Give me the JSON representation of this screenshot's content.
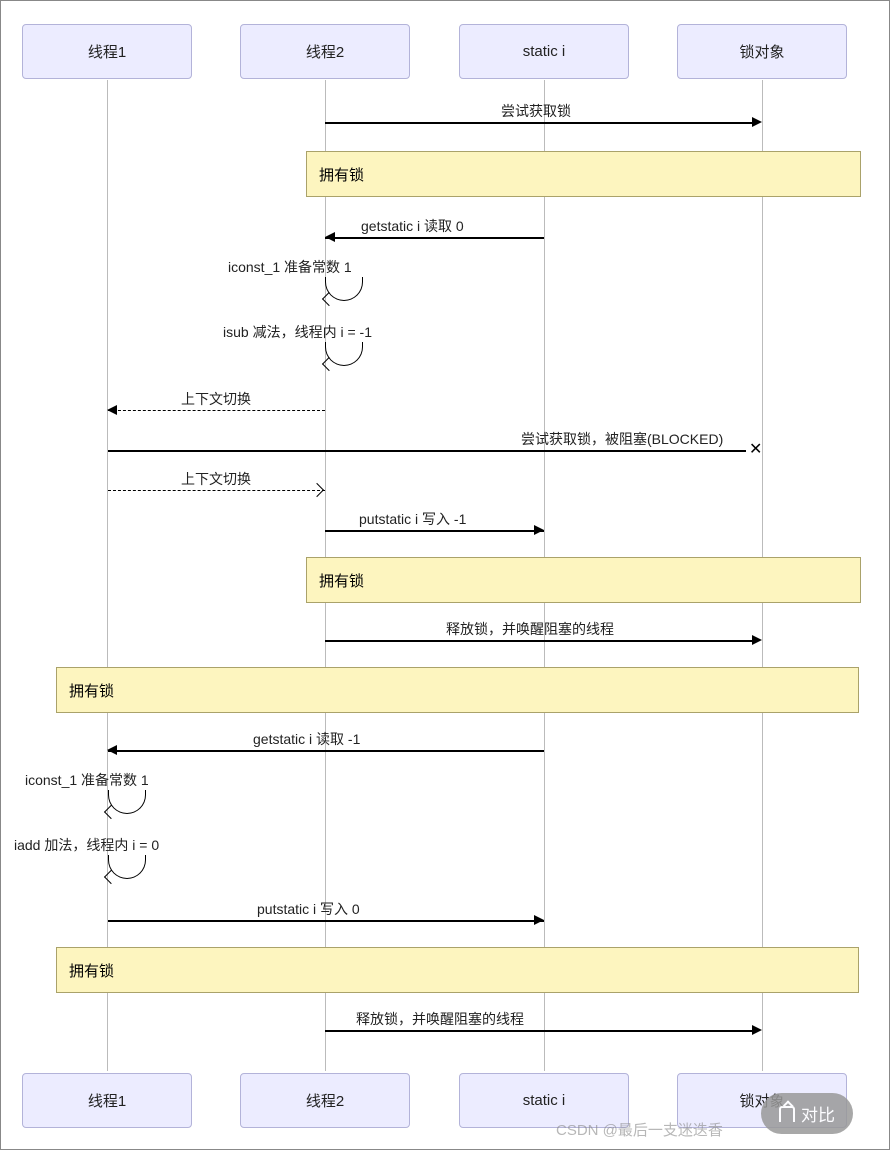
{
  "actors": {
    "a1": "线程1",
    "a2": "线程2",
    "a3": "static i",
    "a4": "锁对象"
  },
  "messages": {
    "m1": "尝试获取锁",
    "n1": "拥有锁",
    "m2": "getstatic i 读取 0",
    "m3": "iconst_1 准备常数 1",
    "m4": "isub 减法，线程内 i = -1",
    "m5": "上下文切换",
    "m6": "尝试获取锁，被阻塞(BLOCKED)",
    "m7": "上下文切换",
    "m8": "putstatic i 写入 -1",
    "n2": "拥有锁",
    "m9": "释放锁，并唤醒阻塞的线程",
    "m9b": "​",
    "n3": "拥有锁",
    "m10": "getstatic i 读取 -1",
    "m11": "iconst_1 准备常数 1",
    "m12": "iadd 加法，线程内 i = 0",
    "m13": "putstatic i 写入 0",
    "n4": "拥有锁",
    "m14": "释放锁，并唤醒阻塞的线程"
  },
  "footer": {
    "watermark": "CSDN @最后一支迷迭香",
    "compare": "对比"
  },
  "chart_data": {
    "type": "sequence-diagram",
    "participants": [
      "线程1",
      "线程2",
      "static i",
      "锁对象"
    ],
    "events": [
      {
        "from": "线程2",
        "to": "锁对象",
        "type": "solid",
        "text": "尝试获取锁"
      },
      {
        "note": "拥有锁",
        "over": [
          "线程2",
          "锁对象"
        ]
      },
      {
        "from": "static i",
        "to": "线程2",
        "type": "solid",
        "text": "getstatic i 读取 0"
      },
      {
        "from": "线程2",
        "to": "线程2",
        "type": "self",
        "text": "iconst_1 准备常数 1"
      },
      {
        "from": "线程2",
        "to": "线程2",
        "type": "self",
        "text": "isub 减法，线程内 i = -1"
      },
      {
        "from": "线程2",
        "to": "线程1",
        "type": "dashed",
        "text": "上下文切换"
      },
      {
        "from": "线程1",
        "to": "锁对象",
        "type": "solid-lost",
        "text": "尝试获取锁，被阻塞(BLOCKED)"
      },
      {
        "from": "线程1",
        "to": "线程2",
        "type": "dashed",
        "text": "上下文切换"
      },
      {
        "from": "线程2",
        "to": "static i",
        "type": "solid",
        "text": "putstatic i 写入 -1"
      },
      {
        "note": "拥有锁",
        "over": [
          "线程2",
          "锁对象"
        ]
      },
      {
        "from": "线程2",
        "to": "锁对象",
        "type": "solid",
        "text": "释放锁，并唤醒阻塞的线程"
      },
      {
        "note": "拥有锁",
        "over": [
          "线程1",
          "锁对象"
        ]
      },
      {
        "from": "static i",
        "to": "线程1",
        "type": "solid",
        "text": "getstatic i 读取 -1"
      },
      {
        "from": "线程1",
        "to": "线程1",
        "type": "self",
        "text": "iconst_1 准备常数 1"
      },
      {
        "from": "线程1",
        "to": "线程1",
        "type": "self",
        "text": "iadd 加法，线程内 i = 0"
      },
      {
        "from": "线程1",
        "to": "static i",
        "type": "solid",
        "text": "putstatic i 写入 0"
      },
      {
        "note": "拥有锁",
        "over": [
          "线程1",
          "锁对象"
        ]
      },
      {
        "from": "线程2",
        "to": "锁对象",
        "type": "solid",
        "text": "释放锁，并唤醒阻塞的线程"
      }
    ]
  }
}
